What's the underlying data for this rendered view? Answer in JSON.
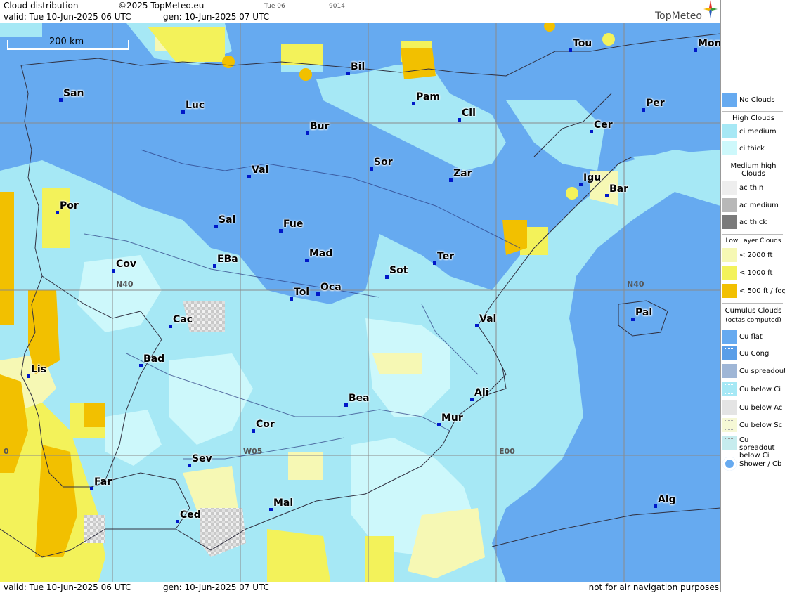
{
  "header": {
    "title": "Cloud distribution",
    "copyright": "©2025 TopMeteo.eu",
    "valid": "valid:  Tue  10-Jun-2025  06 UTC",
    "generated": "gen: 10-Jun-2025 07 UTC",
    "small_day": "Tue 06",
    "small_code": "9014",
    "logo": "TopMeteo"
  },
  "map": {
    "scale_label": "200 km",
    "grid_labels": [
      "N40",
      "N40",
      "W05",
      "E00",
      "0"
    ],
    "cities": [
      {
        "name": "Bil"
      },
      {
        "name": "Tou"
      },
      {
        "name": "Mon"
      },
      {
        "name": "San"
      },
      {
        "name": "Luc"
      },
      {
        "name": "Pam"
      },
      {
        "name": "Cil"
      },
      {
        "name": "Per"
      },
      {
        "name": "Bur"
      },
      {
        "name": "Cer"
      },
      {
        "name": "Val"
      },
      {
        "name": "Sor"
      },
      {
        "name": "Zar"
      },
      {
        "name": "Igu"
      },
      {
        "name": "Bar"
      },
      {
        "name": "Por"
      },
      {
        "name": "Sal"
      },
      {
        "name": "Fue"
      },
      {
        "name": "Mad"
      },
      {
        "name": "Ter"
      },
      {
        "name": "Cov"
      },
      {
        "name": "EBa"
      },
      {
        "name": "Sot"
      },
      {
        "name": "Tol"
      },
      {
        "name": "Oca"
      },
      {
        "name": "Pal"
      },
      {
        "name": "Cac"
      },
      {
        "name": "Val"
      },
      {
        "name": "Bad"
      },
      {
        "name": "Lis"
      },
      {
        "name": "Bea"
      },
      {
        "name": "Ali"
      },
      {
        "name": "Mur"
      },
      {
        "name": "Cor"
      },
      {
        "name": "Sev"
      },
      {
        "name": "Far"
      },
      {
        "name": "Mal"
      },
      {
        "name": "Alg"
      },
      {
        "name": "Ced"
      }
    ]
  },
  "footer": {
    "valid": "valid:  Tue  10-Jun-2025  06 UTC",
    "generated": "gen: 10-Jun-2025 07 UTC",
    "disclaimer": "not for air navigation purposes"
  },
  "legend": {
    "no_clouds": "No Clouds",
    "high_clouds": "High Clouds",
    "ci_medium": "ci medium",
    "ci_thick": "ci thick",
    "medium_high": "Medium high Clouds",
    "ac_thin": "ac thin",
    "ac_medium": "ac medium",
    "ac_thick": "ac thick",
    "low_layer": "Low Layer Clouds",
    "lt2000": "< 2000 ft",
    "lt1000": "< 1000 ft",
    "lt500": "< 500 ft / fog",
    "cumulus": "Cumulus Clouds",
    "octas": "(octas computed)",
    "cu_flat": "Cu flat",
    "cu_cong": "Cu Cong",
    "cu_spreadout": "Cu spreadout",
    "cu_below_ci": "Cu below Ci",
    "cu_below_ac": "Cu below Ac",
    "cu_below_sc": "Cu below Sc",
    "cu_spreadout_below_ci": "Cu spreadout below Ci",
    "shower_cb": "Shower / Cb"
  },
  "colors": {
    "no_clouds": "#66aaf0",
    "ci_medium": "#a6e8f5",
    "ci_thick": "#cdf8fb",
    "lt2000": "#f6f8b4",
    "lt1000": "#f3f25a",
    "lt500": "#f2c000",
    "ac_medium": "#b8b8b8"
  }
}
